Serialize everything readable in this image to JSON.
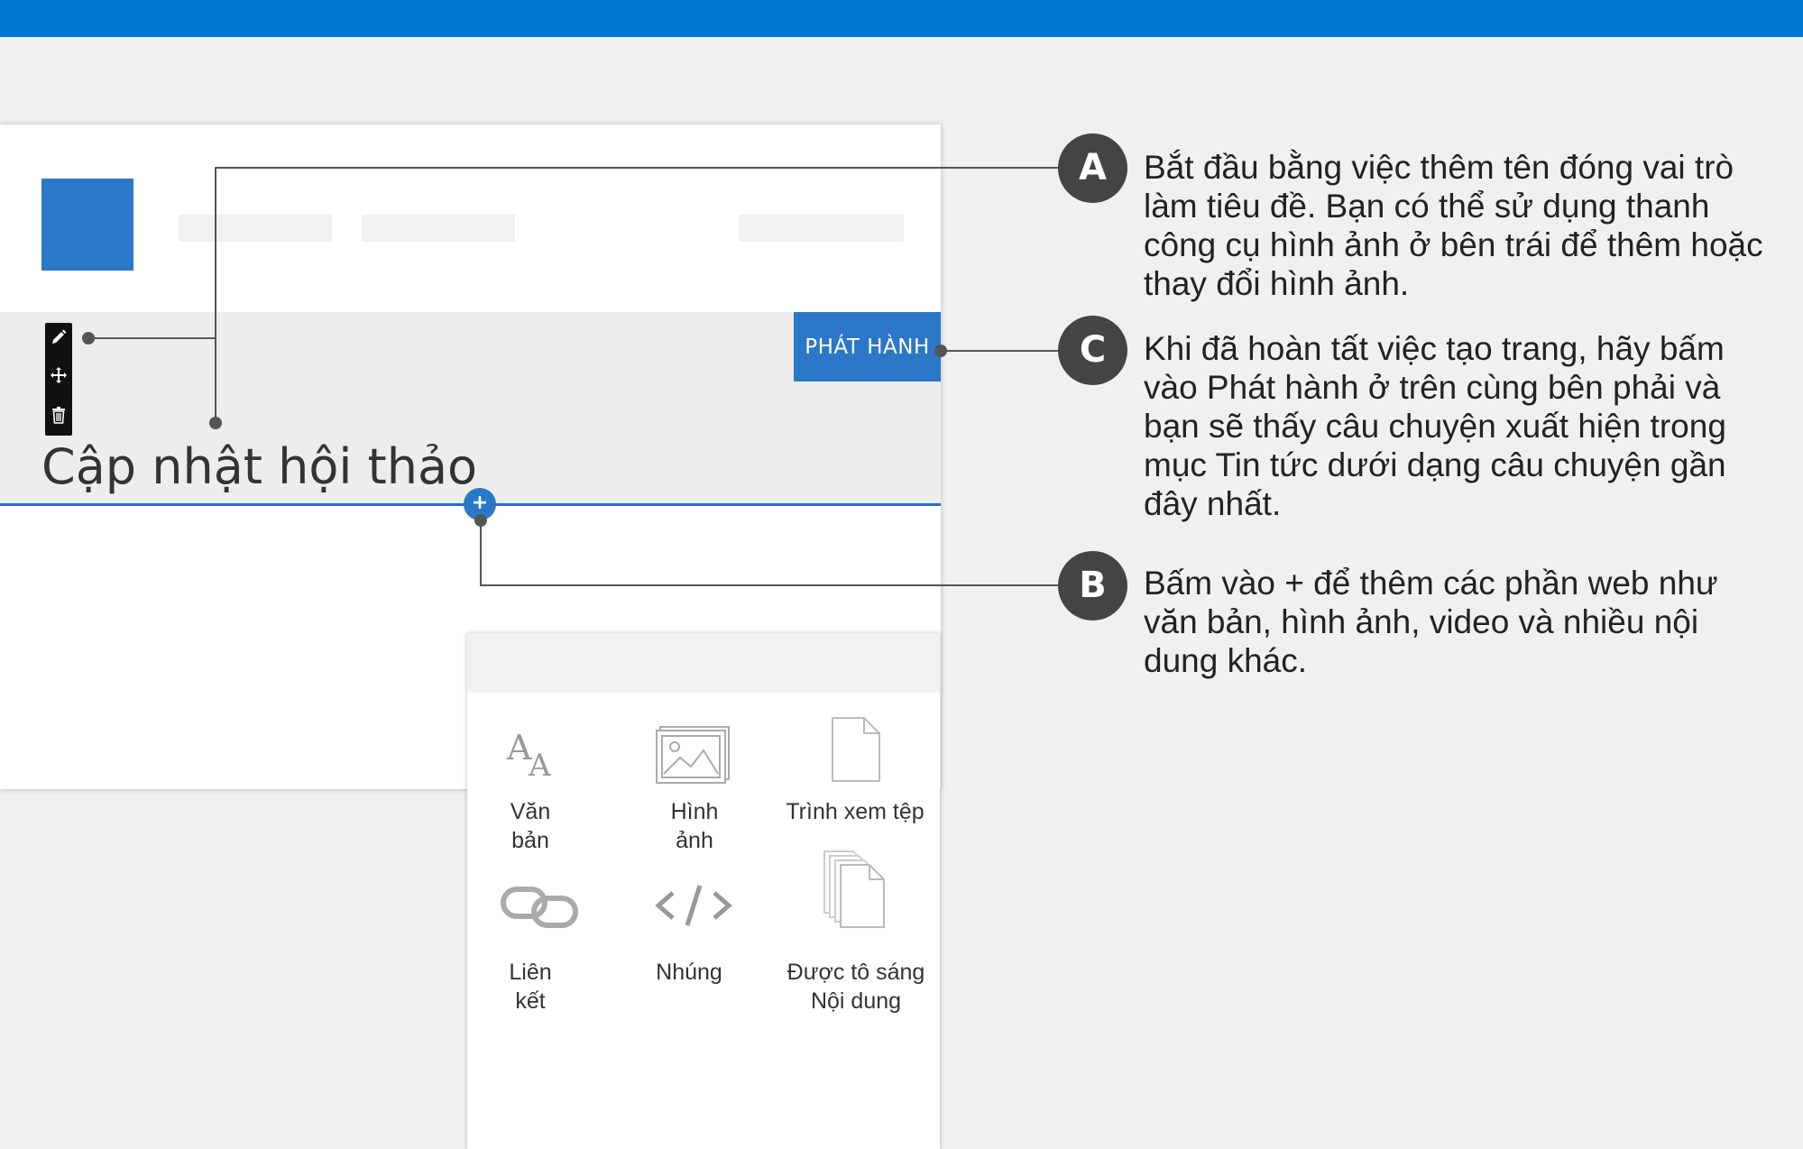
{
  "page": {
    "publish_label": "PHÁT HÀNH",
    "title": "Cập nhật hội thảo",
    "add_symbol": "+"
  },
  "toolbar": {
    "edit_icon": "pencil-icon",
    "move_icon": "move-icon",
    "delete_icon": "trash-icon"
  },
  "picker": {
    "items": [
      {
        "label": "Văn\nbản",
        "icon": "text-icon"
      },
      {
        "label": "Hình\nảnh",
        "icon": "image-icon"
      },
      {
        "label": "Trình xem tệp",
        "icon": "file-icon"
      },
      {
        "label": "Liên\nkết",
        "icon": "link-icon"
      },
      {
        "label": "Nhúng",
        "icon": "embed-icon"
      },
      {
        "label": "Được tô sáng\nNội dung",
        "icon": "highlighted-content-icon"
      }
    ]
  },
  "callouts": {
    "a": {
      "letter": "A",
      "text": "Bắt đầu bằng việc thêm tên đóng vai trò làm tiêu đề. Bạn có thể sử dụng thanh công cụ hình ảnh ở bên trái để thêm hoặc thay đổi hình ảnh."
    },
    "c": {
      "letter": "C",
      "text": "Khi đã hoàn tất việc tạo trang, hãy bấm vào Phát hành ở trên cùng bên phải và bạn sẽ thấy câu chuyện xuất hiện trong mục Tin tức dưới dạng câu chuyện gần đây nhất."
    },
    "b": {
      "letter": "B",
      "text": "Bấm vào + để thêm các phần web như văn bản, hình ảnh, video và nhiều nội dung khác."
    }
  },
  "colors": {
    "accent": "#0078d4",
    "brand_blue": "#2b78c9",
    "badge": "#444444"
  }
}
